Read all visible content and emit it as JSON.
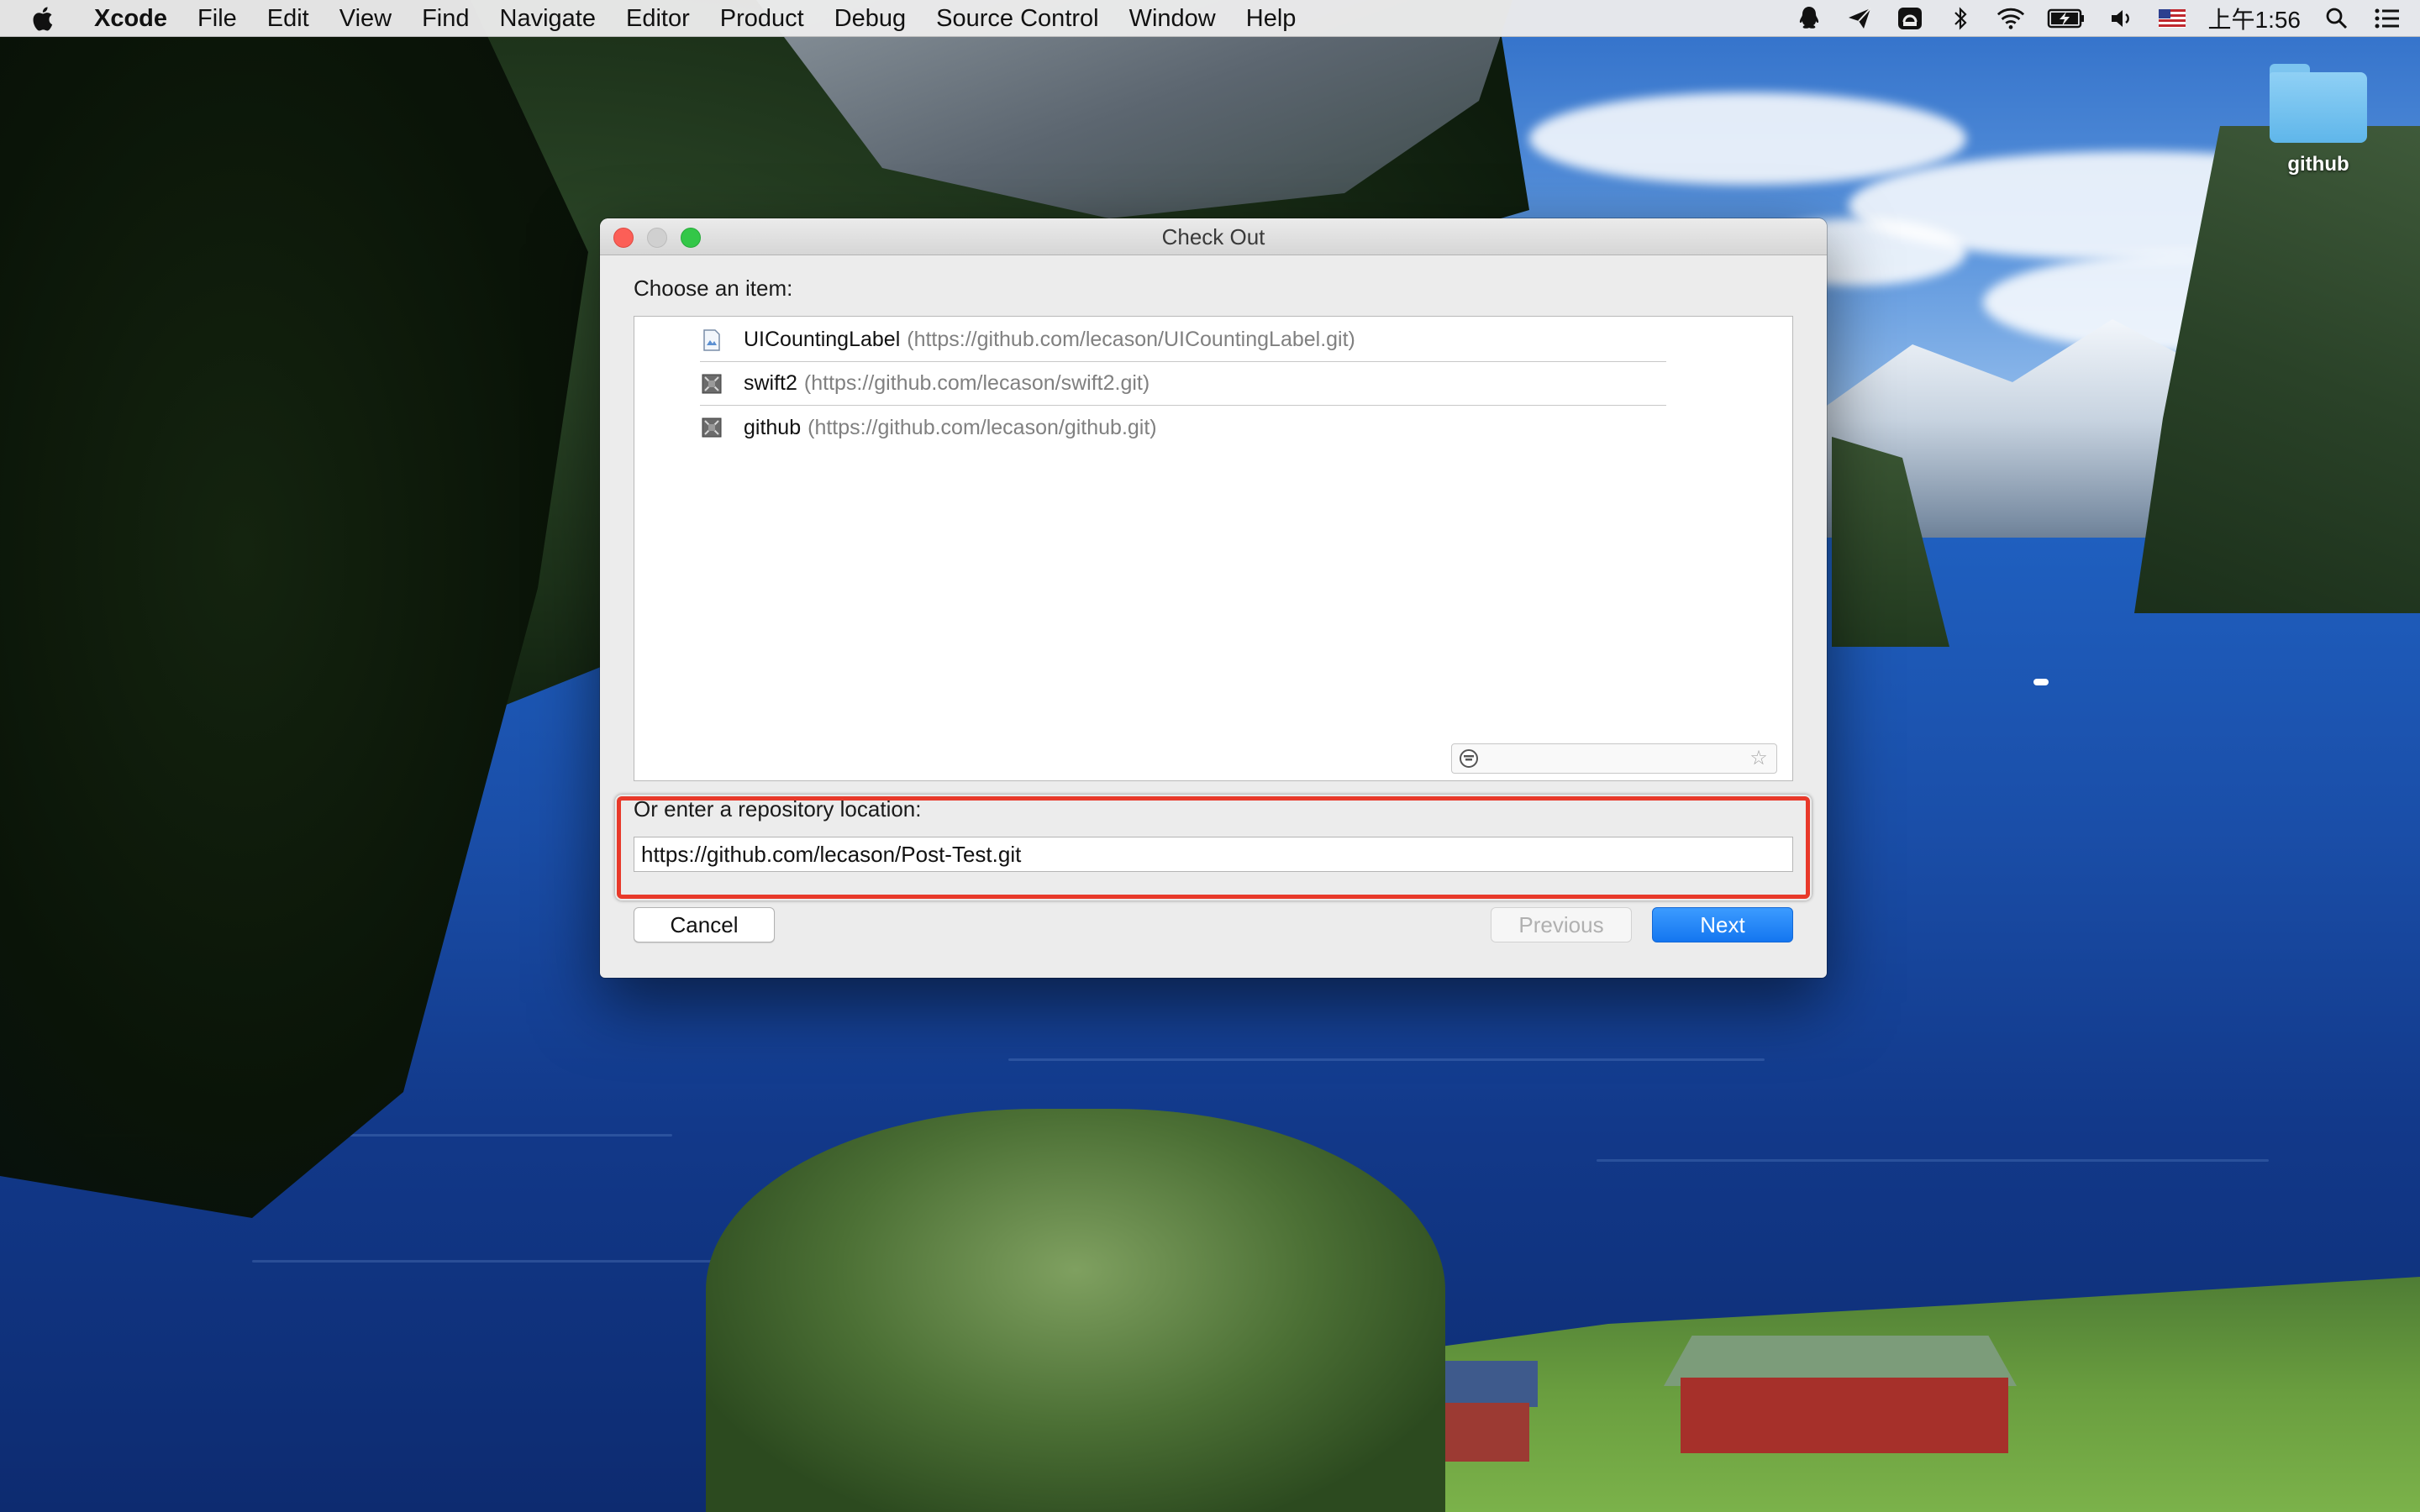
{
  "menubar": {
    "app_name": "Xcode",
    "items": [
      "File",
      "Edit",
      "View",
      "Find",
      "Navigate",
      "Editor",
      "Product",
      "Debug",
      "Source Control",
      "Window",
      "Help"
    ],
    "clock": "上午1:56",
    "status_icons": [
      "qq-icon",
      "send-icon",
      "airplay-display-icon",
      "bluetooth-icon",
      "wifi-icon",
      "battery-charging-icon",
      "volume-icon",
      "us-flag-input-icon",
      "spotlight-search-icon",
      "notification-center-icon"
    ]
  },
  "desktop": {
    "folder_label": "github"
  },
  "dialog": {
    "title": "Check Out",
    "choose_label": "Choose an item:",
    "items": [
      {
        "name": "UICountingLabel",
        "url": "(https://github.com/lecason/UICountingLabel.git)",
        "icon": "repository-doc-icon"
      },
      {
        "name": "swift2",
        "url": "(https://github.com/lecason/swift2.git)",
        "icon": "repository-icon"
      },
      {
        "name": "github",
        "url": "(https://github.com/lecason/github.git)",
        "icon": "repository-icon"
      }
    ],
    "repo_location_label": "Or enter a repository location:",
    "repo_location_value": "https://github.com/lecason/Post-Test.git",
    "buttons": {
      "cancel": "Cancel",
      "previous": "Previous",
      "next": "Next"
    },
    "highlight_color": "#e8392a",
    "accent_color": "#1476f0"
  }
}
